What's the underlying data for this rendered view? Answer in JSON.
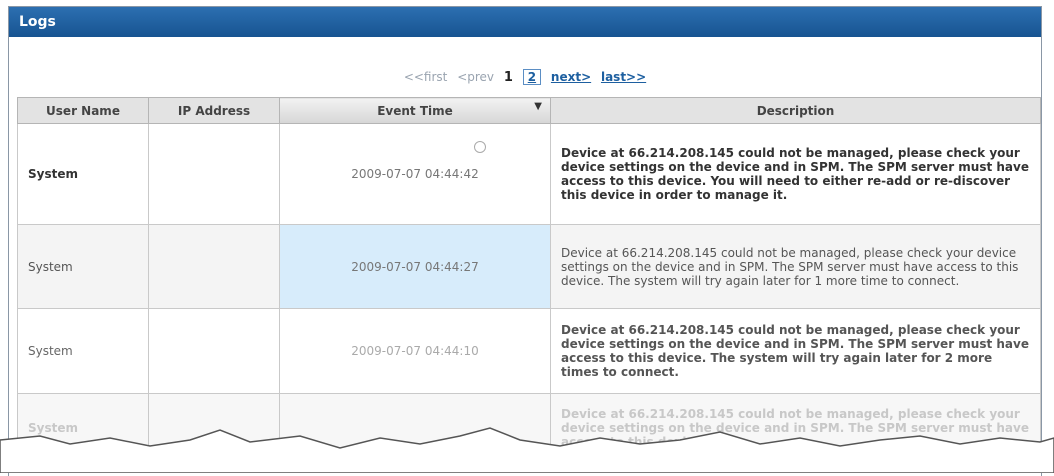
{
  "panel": {
    "title": "Logs"
  },
  "pager": {
    "first": "<<first",
    "prev": "<prev",
    "page_current": "1",
    "page_2": "2",
    "next": "next>",
    "last": "last>>"
  },
  "table": {
    "columns": [
      "User Name",
      "IP Address",
      "Event Time",
      "Description"
    ],
    "rows": [
      {
        "user": "System",
        "ip": "",
        "time": "2009-07-07 04:44:42",
        "desc": "Device at 66.214.208.145 could not be managed, please check your device settings on the device and in SPM. The SPM server must have access to this device. You will need to either re-add or re-discover this device in order to manage it."
      },
      {
        "user": "System",
        "ip": "",
        "time": "2009-07-07 04:44:27",
        "desc": "Device at 66.214.208.145 could not be managed, please check your device settings on the device and in SPM. The SPM server must have access to this device. The system will try again later for 1 more time to connect."
      },
      {
        "user": "System",
        "ip": "",
        "time": "2009-07-07 04:44:10",
        "desc": "Device at 66.214.208.145 could not be managed, please check your device settings on the device and in SPM. The SPM server must have access to this device. The system will try again later for 2 more times to connect."
      },
      {
        "user": "System",
        "ip": "",
        "time": "",
        "desc": "Device at 66.214.208.145 could not be managed, please check your device settings on the device and in SPM. The SPM server must have access to this device. The"
      }
    ]
  },
  "colors": {
    "titlebar": "#1d5fa0",
    "highlight": "#d7ecfb"
  }
}
